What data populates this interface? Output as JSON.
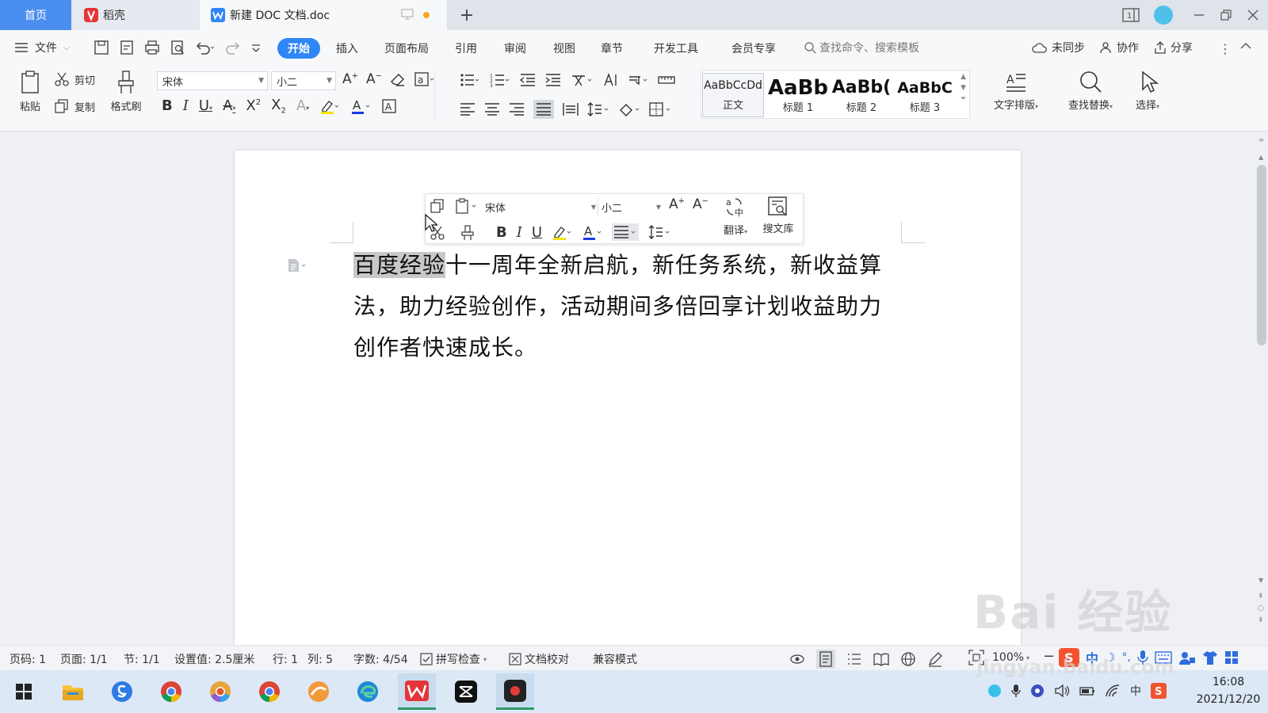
{
  "titlebar": {
    "home_tab": "首页",
    "daoke_tab": "稻壳",
    "doc_tab": "新建 DOC 文档.doc",
    "add_tab": "+"
  },
  "menu": {
    "file": "文件",
    "tabs": [
      "开始",
      "插入",
      "页面布局",
      "引用",
      "审阅",
      "视图",
      "章节",
      "开发工具",
      "会员专享"
    ],
    "search_placeholder": "查找命令、搜索模板",
    "sync": "未同步",
    "collab": "协作",
    "share": "分享"
  },
  "ribbon": {
    "paste": "粘贴",
    "cut": "剪切",
    "copy": "复制",
    "format_painter": "格式刷",
    "font_name": "宋体",
    "font_size": "小二",
    "styles": [
      {
        "preview": "AaBbCcDd",
        "label": "正文"
      },
      {
        "preview": "AaBb",
        "label": "标题 1"
      },
      {
        "preview": "AaBb(",
        "label": "标题 2"
      },
      {
        "preview": "AaBbC",
        "label": "标题 3"
      }
    ],
    "text_layout": "文字排版",
    "find_replace": "查找替换",
    "select": "选择"
  },
  "float_toolbar": {
    "font_name": "宋体",
    "font_size": "小二",
    "translate": "翻译",
    "search_library": "搜文库"
  },
  "document": {
    "selected_text": "百度经验",
    "line1_rest": "十一周年全新启航，新任务系统，新收益算",
    "line2": "法，助力经验创作，活动期间多倍回享计划收益助力",
    "line3": "创作者快速成长。"
  },
  "statusbar": {
    "page_num": "页码: 1",
    "pages": "页面: 1/1",
    "section": "节: 1/1",
    "setting": "设置值: 2.5厘米",
    "row": "行: 1",
    "col": "列: 5",
    "word_count": "字数: 4/54",
    "spell_check": "拼写检查",
    "doc_check": "文档校对",
    "compat_mode": "兼容模式",
    "zoom": "100%"
  },
  "taskbar": {
    "time": "16:08",
    "date": "2021/12/20",
    "ime": "中"
  },
  "watermark": {
    "text": "Bai 经验",
    "url": "jingyan.baidu.com"
  },
  "colors": {
    "accent": "#2f86f6",
    "home_tab": "#4a8ef0",
    "selection": "#c8c8c8"
  }
}
